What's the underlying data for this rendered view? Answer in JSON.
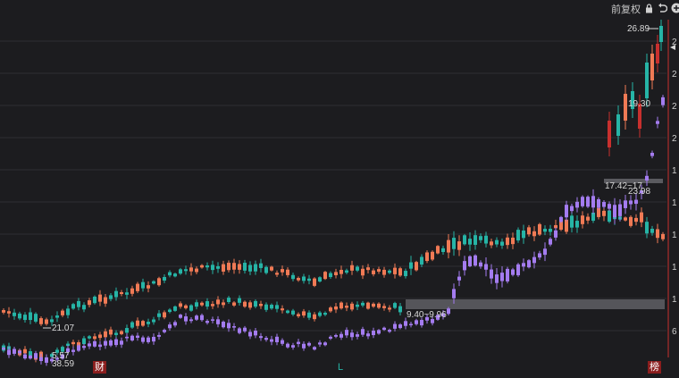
{
  "toolbar": {
    "adjust_label": "前复权",
    "lock_icon": "lock-icon",
    "undo_icon": "undo-icon",
    "add_icon": "plus-circle-icon"
  },
  "colors": {
    "background": "#1c1c1f",
    "grid": "#2e2e33",
    "up": "#f07a55",
    "down": "#26b4a6",
    "purple": "#a47cf0",
    "red_line": "#c8302e",
    "band": "#5a5a5f",
    "label": "#d8d8d8",
    "marker_bg": "#8b1e1e"
  },
  "annotations": {
    "high_price": "26.89",
    "mid_price": "19.30",
    "range_high": "17.42~17",
    "purple_high": "23.98",
    "range_low": "9.40~9.96",
    "low_price": "21.07",
    "low_purple": "5.57",
    "low_purple2": "38.59"
  },
  "right_axis_labels": [
    "2",
    "2",
    "2",
    "2",
    "1",
    "1",
    "1",
    "1",
    "1",
    "6"
  ],
  "markers": {
    "earnings": "财",
    "l_marker": "L",
    "ranking": "榜"
  },
  "chart_data": {
    "type": "candlestick",
    "series": [
      {
        "name": "",
        "color_up": "#f07a55",
        "color_down": "#26b4a6"
      },
      {
        "name": "",
        "color_up": "#a47cf0",
        "color_down": "#a47cf0"
      }
    ]
  }
}
